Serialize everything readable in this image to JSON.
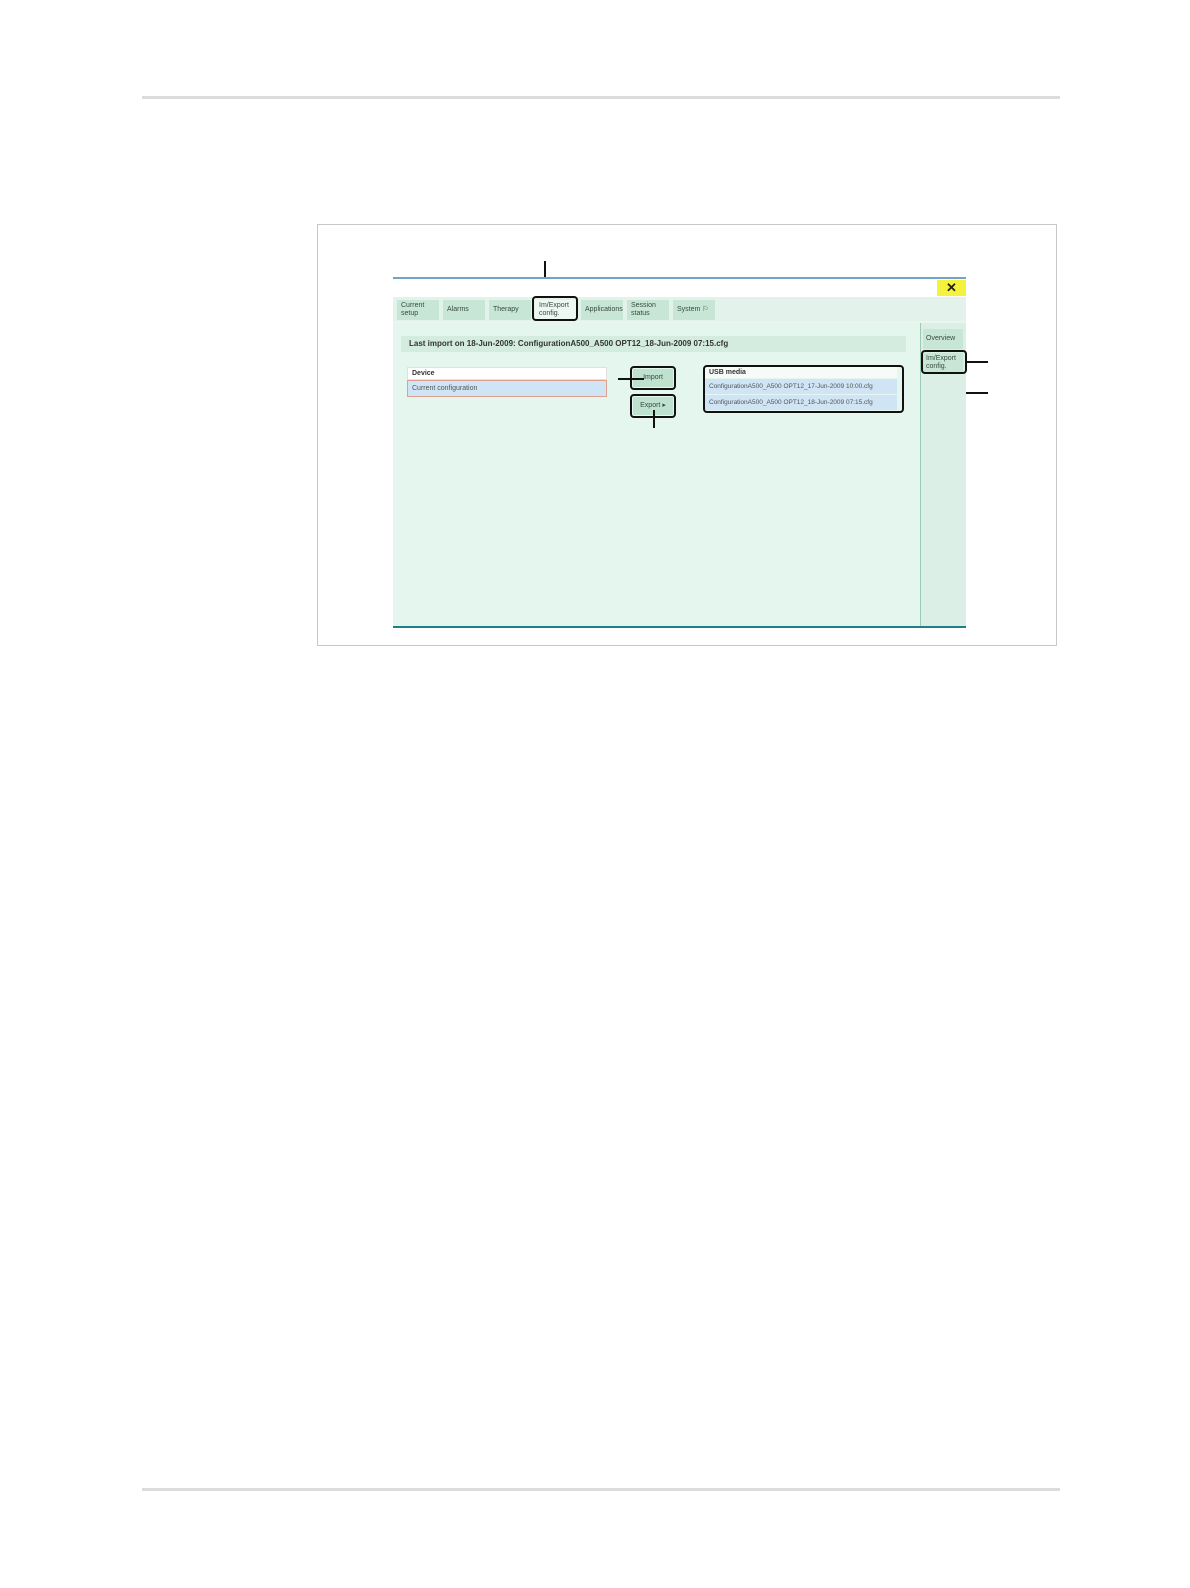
{
  "window": {
    "close_label": "✕"
  },
  "tabs": [
    {
      "label": "Current setup"
    },
    {
      "label": "Alarms"
    },
    {
      "label": "Therapy"
    },
    {
      "label": "Im/Export config."
    },
    {
      "label": "Applications"
    },
    {
      "label": "Session status"
    },
    {
      "label": "System ⚐"
    }
  ],
  "side_menu": {
    "overview": "Overview",
    "im_export": "Im/Export config."
  },
  "last_import": "Last import on 18-Jun-2009:   ConfigurationA500_A500 OPT12_18-Jun-2009 07:15.cfg",
  "device_list": {
    "header": "Device",
    "items": [
      "Current configuration"
    ]
  },
  "buttons": {
    "import": "Import",
    "export": "Export ▸"
  },
  "usb_list": {
    "header": "USB media",
    "items": [
      "ConfigurationA500_A500 OPT12_17-Jun-2009 10:00.cfg",
      "ConfigurationA500_A500 OPT12_18-Jun-2009 07:15.cfg"
    ]
  }
}
